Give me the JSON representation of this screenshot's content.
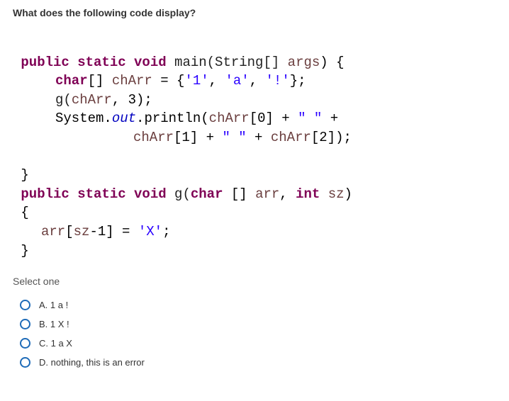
{
  "question": "What does the following code display?",
  "code": {
    "l1": {
      "kw": "public static void",
      "fn": " main(String[] ",
      "arg": "args",
      "end": ") {"
    },
    "l2": {
      "kw": "char",
      "txt1": "[] ",
      "var": "chArr",
      "txt2": " = {",
      "s1": "'1'",
      "c1": ", ",
      "s2": "'a'",
      "c2": ", ",
      "s3": "'!'",
      "end": "};"
    },
    "l3": {
      "fn": "g(",
      "var": "chArr",
      "txt": ", 3);"
    },
    "l4": {
      "txt1": "System.",
      "ital": "out",
      "txt2": ".println(",
      "var": "chArr",
      "txt3": "[0] + ",
      "str": "\" \"",
      "txt4": " +"
    },
    "l5": {
      "var": "chArr",
      "txt1": "[1] + ",
      "str": "\" \"",
      "txt2": " + ",
      "var2": "chArr",
      "txt3": "[2]);"
    },
    "l6": {
      "txt": "}"
    },
    "l7": {
      "kw": "public static void",
      "fn": " g(",
      "kw2": "char",
      "txt": " [] ",
      "arg1": "arr",
      "c": ", ",
      "kw3": "int",
      "sp": " ",
      "arg2": "sz",
      "end": ")"
    },
    "l8": {
      "txt": "{"
    },
    "l9": {
      "var1": "arr",
      "txt1": "[",
      "var2": "sz",
      "txt2": "-1] = ",
      "str": "'X'",
      "end": ";"
    },
    "l10": {
      "txt": "}"
    }
  },
  "prompt": "Select one",
  "options": [
    {
      "letter": "A.",
      "text": "1 a !"
    },
    {
      "letter": "B.",
      "text": "1 X !"
    },
    {
      "letter": "C.",
      "text": "1 a X"
    },
    {
      "letter": "D.",
      "text": "nothing, this is an error"
    }
  ]
}
